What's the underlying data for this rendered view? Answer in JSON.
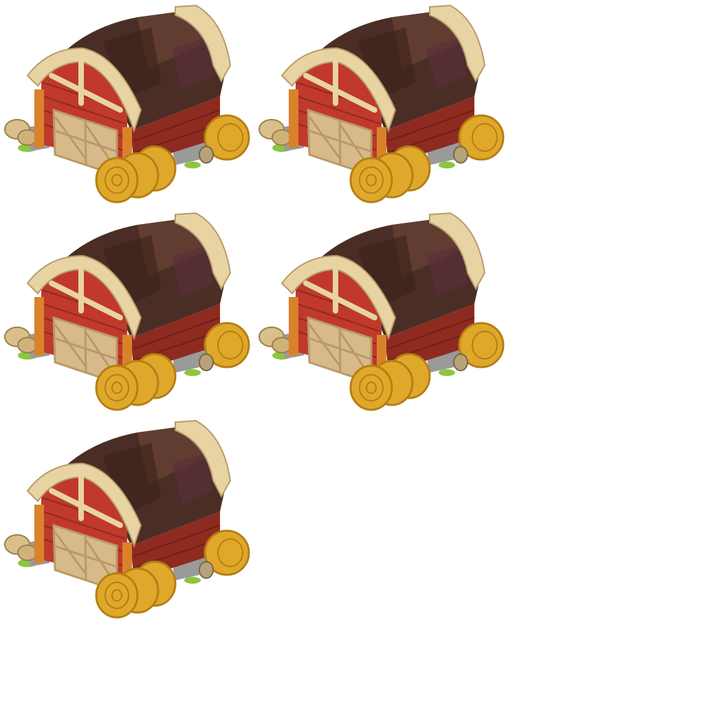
{
  "sprite_sheet": {
    "background": "#ffffff",
    "sprites": [
      {
        "name": "barn-sprite",
        "icon": "barn-icon"
      },
      {
        "name": "barn-sprite",
        "icon": "barn-icon"
      },
      {
        "name": "barn-sprite",
        "icon": "barn-icon"
      },
      {
        "name": "barn-sprite",
        "icon": "barn-icon"
      },
      {
        "name": "barn-sprite",
        "icon": "barn-icon"
      }
    ]
  },
  "colors": {
    "barn_red": "#c0392b",
    "barn_red_dark": "#8e2b20",
    "roof_brown": "#4a2e25",
    "roof_brown_light": "#6b4436",
    "trim_cream": "#e8d3a3",
    "trim_shadow": "#b89a6a",
    "hay_gold": "#e0a82a",
    "hay_dark": "#b57e14",
    "stone_gray": "#9a9a9a",
    "grass_green": "#8cc63f",
    "post_orange": "#d9822b"
  }
}
